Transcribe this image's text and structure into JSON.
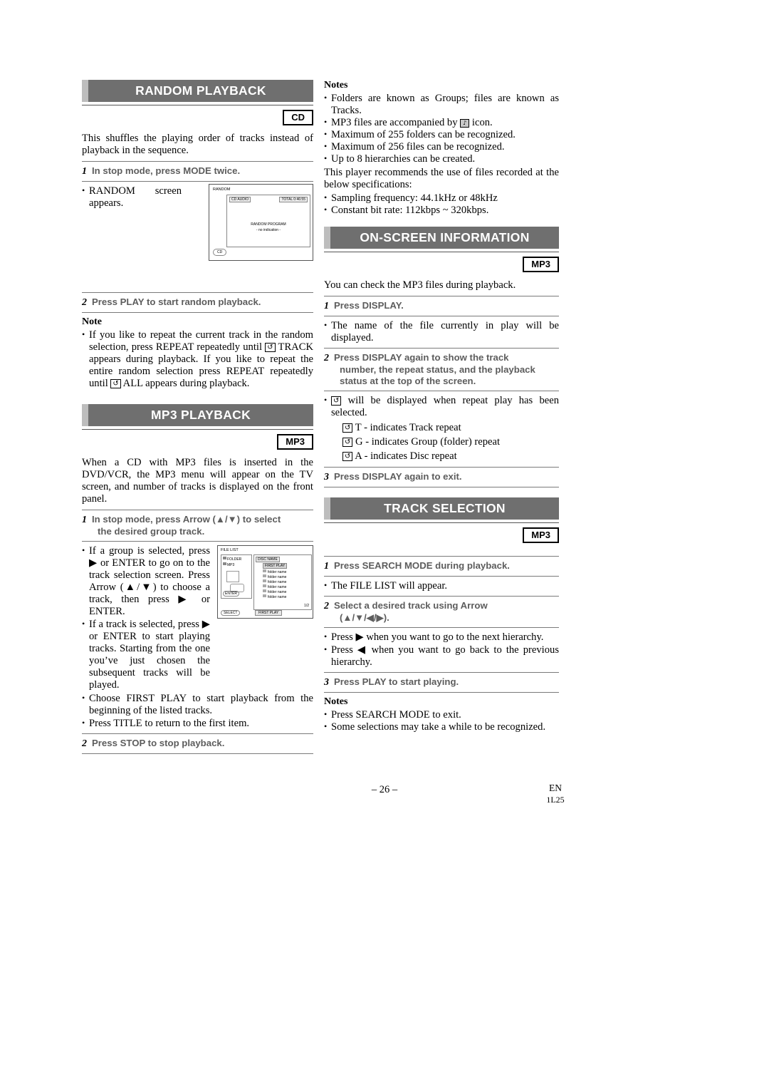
{
  "page": {
    "number": "– 26 –",
    "lang": "EN",
    "code": "1L25"
  },
  "sections": {
    "random_playback": {
      "title": "RANDOM PLAYBACK",
      "badge": "CD",
      "intro": "This shuffles the playing order of tracks instead of playback in the sequence.",
      "step1": {
        "num": "1",
        "text": "In stop mode, press MODE twice."
      },
      "bullet1": "RANDOM screen appears.",
      "step2": {
        "num": "2",
        "text": "Press PLAY to start random playback."
      },
      "note_label": "Note",
      "note_text": "If you like to repeat the current track in the random selection, press REPEAT repeatedly until  TRACK appears during playback. If you like to repeat the entire random selection press REPEAT repeatedly until  ALL appears during playback.",
      "note_part1": "If you like to repeat the current track in the random selection, press REPEAT repeatedly until",
      "note_part2": "TRACK appears during playback. If you like to repeat the entire random selection press REPEAT repeatedly until",
      "note_part3": "ALL appears during playback.",
      "screen": {
        "title": "RANDOM",
        "left_tag": "CD AUDIO",
        "right_tag": "TOTAL 0:46:55",
        "center_line1": "RANDOM PROGRAM",
        "center_line2": "- no indication -",
        "badge": "CD"
      }
    },
    "mp3_playback": {
      "title": "MP3 PLAYBACK",
      "badge": "MP3",
      "intro": "When a CD with MP3 files is inserted in the DVD/VCR, the MP3 menu will appear on the TV screen, and number of tracks is displayed on the front panel.",
      "step1": {
        "num": "1",
        "text": "In stop mode, press Arrow (▲/▼) to select",
        "text2": "the desired group track."
      },
      "bullets": [
        "If a group is selected, press ▶ or ENTER to go on to the track selection screen. Press Arrow (▲/▼) to choose a track, then press ▶ or ENTER.",
        "If a track is selected, press ▶ or ENTER to start playing tracks. Starting from the one you’ve just chosen the subsequent tracks will be played.",
        "Choose FIRST PLAY to start playback from the beginning of the listed tracks.",
        "Press TITLE to return to the first item."
      ],
      "step2": {
        "num": "2",
        "text": "Press STOP to stop playback."
      },
      "screen": {
        "title": "FILE LIST",
        "disc_name": "DISC NAME",
        "folder_tag": "FOLDER",
        "mp3_tag": "MP3",
        "first_play": "FIRST PLAY",
        "folder_items": [
          "folder name",
          "folder name",
          "folder name",
          "folder name",
          "folder name",
          "folder name"
        ],
        "page": "1/2",
        "bottom_label": "FIRST PLAY",
        "enter_label": "ENTER",
        "select_label": "SELECT"
      }
    },
    "notes_mp3": {
      "label": "Notes",
      "items": [
        "Folders are known as Groups; files are known as Tracks.",
        "MP3 files are accompanied by  icon.",
        "Maximum of 255 folders can be recognized.",
        "Maximum of 256 files can be recognized.",
        "Up to 8 hierarchies can be created."
      ],
      "item2_pre": "MP3 files are accompanied by",
      "item2_post": "icon.",
      "spec_intro": "This player recommends the use of files recorded at the below specifications:",
      "spec_items": [
        "Sampling frequency: 44.1kHz or 48kHz",
        "Constant bit rate: 112kbps ~ 320kbps."
      ]
    },
    "on_screen_information": {
      "title": "ON-SCREEN INFORMATION",
      "badge": "MP3",
      "intro": "You can check the MP3 files during playback.",
      "step1": {
        "num": "1",
        "text": "Press DISPLAY."
      },
      "bullet1": "The name of the file currently in play will be displayed.",
      "step2": {
        "num": "2",
        "text": "Press DISPLAY again to show the track",
        "text2": "number, the repeat status, and the playback",
        "text3": "status at the top of the screen."
      },
      "bullet2": "will be displayed when repeat play has been selected.",
      "repeat_lines": [
        "T - indicates Track repeat",
        "G - indicates Group (folder) repeat",
        "A - indicates Disc repeat"
      ],
      "step3": {
        "num": "3",
        "text": "Press DISPLAY again to exit."
      }
    },
    "track_selection": {
      "title": "TRACK SELECTION",
      "badge": "MP3",
      "step1": {
        "num": "1",
        "text": "Press SEARCH MODE during playback."
      },
      "bullet1": "The FILE LIST will appear.",
      "step2": {
        "num": "2",
        "text": "Select a desired track using Arrow",
        "text2": "(▲/▼/◀/▶)."
      },
      "bullets2": [
        "Press ▶ when you want to go to the next hierarchy.",
        "Press ◀ when you want to go back to the previous hierarchy."
      ],
      "step3": {
        "num": "3",
        "text": "Press PLAY to start playing."
      },
      "notes_label": "Notes",
      "notes": [
        "Press SEARCH MODE to exit.",
        "Some selections may take a while to be recognized."
      ]
    }
  }
}
